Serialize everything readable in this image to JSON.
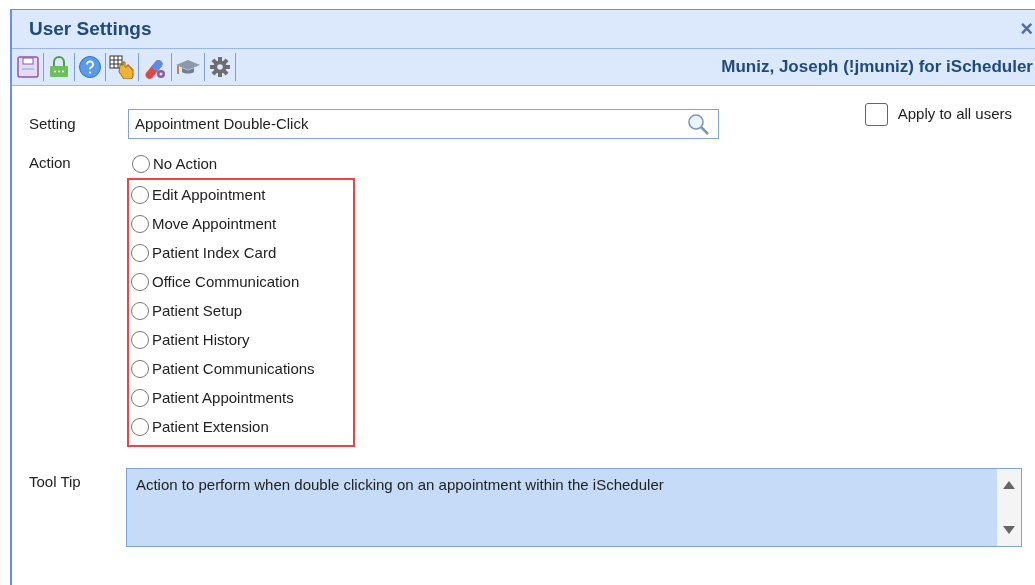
{
  "window": {
    "title": "User Settings",
    "close": "×"
  },
  "toolbar": {
    "user": "Muniz, Joseph (!jmuniz) for iScheduler"
  },
  "setting": {
    "label": "Setting",
    "value": "Appointment Double-Click"
  },
  "apply_all": {
    "label": "Apply to all users",
    "checked": false
  },
  "action": {
    "label": "Action",
    "options": [
      {
        "label": "No Action",
        "selected": false
      }
    ],
    "highlighted_options": [
      {
        "label": "Edit Appointment",
        "selected": false
      },
      {
        "label": "Move Appointment",
        "selected": false
      },
      {
        "label": "Patient Index Card",
        "selected": false
      },
      {
        "label": "Office Communication",
        "selected": false
      },
      {
        "label": "Patient Setup",
        "selected": false
      },
      {
        "label": "Patient History",
        "selected": false
      },
      {
        "label": "Patient Communications",
        "selected": false
      },
      {
        "label": "Patient Appointments",
        "selected": false
      },
      {
        "label": "Patient Extension",
        "selected": false
      }
    ]
  },
  "tooltip": {
    "label": "Tool Tip",
    "value": "Action to perform when double clicking on an appointment within the iScheduler"
  }
}
